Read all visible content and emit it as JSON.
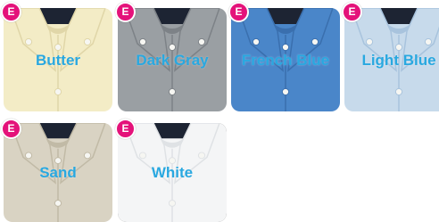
{
  "swatches": [
    {
      "label": "Butter",
      "badge": "E",
      "color": "#f3ecc6",
      "shade": "#e0d6a8"
    },
    {
      "label": "Dark Gray",
      "badge": "E",
      "color": "#9a9fa3",
      "shade": "#7d8287"
    },
    {
      "label": "French Blue",
      "badge": "E",
      "color": "#4a86c9",
      "shade": "#3a6fae"
    },
    {
      "label": "Light Blue",
      "badge": "E",
      "color": "#c7daeb",
      "shade": "#a8c3dd"
    },
    {
      "label": "Sand",
      "badge": "E",
      "color": "#d9d3c3",
      "shade": "#c1baa6"
    },
    {
      "label": "White",
      "badge": "E",
      "color": "#f4f5f6",
      "shade": "#dfe2e5",
      "selected": true
    }
  ],
  "colors": {
    "label": "#29a8e0",
    "badge": "#e4127a",
    "collar_tag": "#1d2433"
  }
}
